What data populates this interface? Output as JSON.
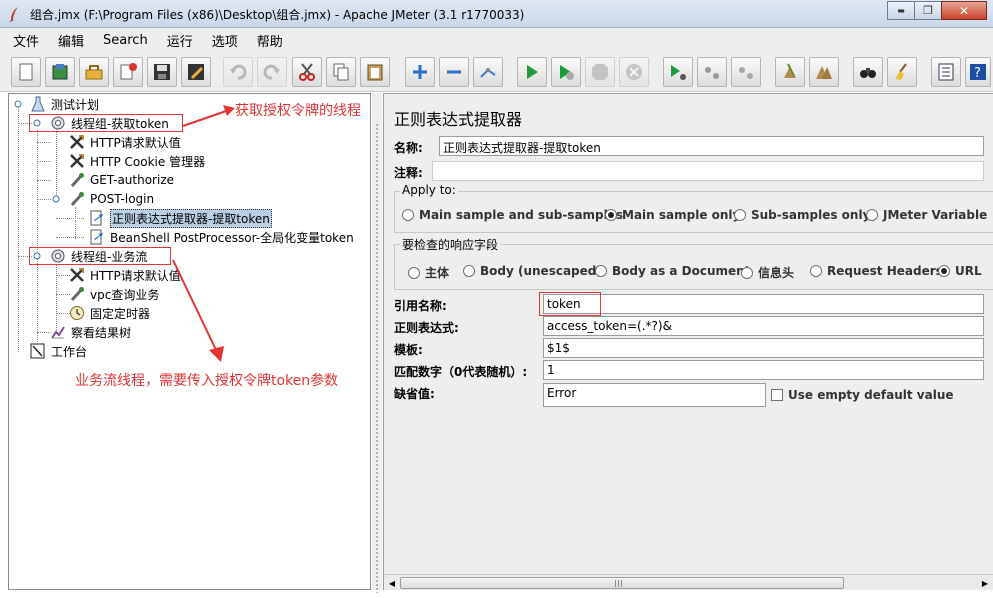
{
  "window": {
    "title": "组合.jmx (F:\\Program Files (x86)\\Desktop\\组合.jmx) - Apache JMeter (3.1 r1770033)",
    "minimize": "▬",
    "maximize": "❐",
    "close": "✕"
  },
  "menu": [
    "文件",
    "编辑",
    "Search",
    "运行",
    "选项",
    "帮助"
  ],
  "toolbar_icons": [
    "new-icon",
    "templates-icon",
    "open-icon",
    "close-icon",
    "save-icon",
    "save-as-icon",
    "undo-icon",
    "redo-icon",
    "cut-icon",
    "copy-icon",
    "paste-icon",
    "expand-icon",
    "collapse-icon",
    "toggle-icon",
    "start-icon",
    "start-no-timers-icon",
    "stop-icon",
    "shutdown-icon",
    "remote-start-icon",
    "remote-stop-icon",
    "remote-shutdown-icon",
    "clear-icon",
    "clear-all-icon",
    "search-icon",
    "reset-search-icon",
    "function-helper-icon",
    "help-icon"
  ],
  "tree": {
    "items": [
      {
        "label": "测试计划",
        "icon": "test-plan-icon"
      },
      {
        "label": "线程组-获取token",
        "icon": "thread-group-icon"
      },
      {
        "label": "HTTP请求默认值",
        "icon": "config-element-icon"
      },
      {
        "label": "HTTP Cookie 管理器",
        "icon": "config-element-icon"
      },
      {
        "label": "GET-authorize",
        "icon": "sampler-icon"
      },
      {
        "label": "POST-login",
        "icon": "sampler-icon"
      },
      {
        "label": "正则表达式提取器-提取token",
        "icon": "post-processor-icon"
      },
      {
        "label": "BeanShell PostProcessor-全局化变量token",
        "icon": "post-processor-icon"
      },
      {
        "label": "线程组-业务流",
        "icon": "thread-group-icon"
      },
      {
        "label": "HTTP请求默认值",
        "icon": "config-element-icon"
      },
      {
        "label": "vpc查询业务",
        "icon": "sampler-icon"
      },
      {
        "label": "固定定时器",
        "icon": "timer-icon"
      },
      {
        "label": "察看结果树",
        "icon": "listener-icon"
      },
      {
        "label": "工作台",
        "icon": "workbench-icon"
      }
    ]
  },
  "annotations": {
    "top": "获取授权令牌的线程",
    "bottom": "业务流线程，需要传入授权令牌token参数"
  },
  "panel": {
    "title": "正则表达式提取器",
    "name_label": "名称:",
    "name_value": "正则表达式提取器-提取token",
    "comment_label": "注释:",
    "comment_value": "",
    "apply_to": {
      "title": "Apply to:",
      "options": [
        "Main sample and sub-samples",
        "Main sample only",
        "Sub-samples only",
        "JMeter Variable"
      ],
      "selected": "Main sample only"
    },
    "field_to_check": {
      "title": "要检查的响应字段",
      "options": [
        "主体",
        "Body (unescaped)",
        "Body as a Document",
        "信息头",
        "Request Headers",
        "URL"
      ],
      "selected": "URL"
    },
    "ref_name_label": "引用名称:",
    "ref_name_value": "token",
    "regex_label": "正则表达式:",
    "regex_value": "access_token=(.*?)&",
    "template_label": "模板:",
    "template_value": "$1$",
    "match_no_label": "匹配数字（0代表随机）:",
    "match_no_value": "1",
    "default_label": "缺省值:",
    "default_value": "Error",
    "use_empty_default_label": "Use empty default value",
    "use_empty_default_checked": false
  },
  "colors": {
    "annotation": "#e23434",
    "selection": "#b8cfe5",
    "panel_bg": "#eeeeee"
  }
}
